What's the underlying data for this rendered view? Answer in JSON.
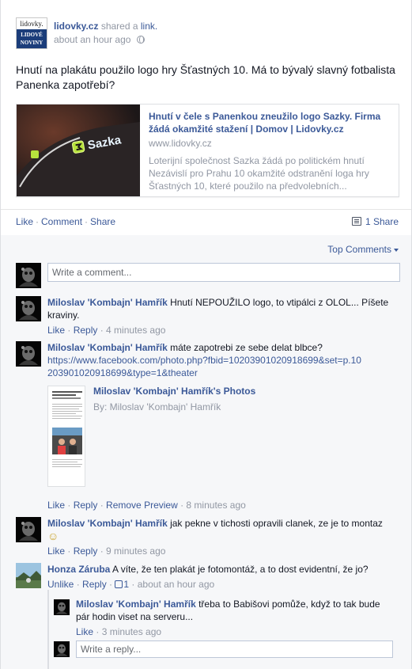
{
  "post": {
    "page_name": "lidovky.cz",
    "verb": "shared a",
    "verb_link": "link.",
    "timestamp": "about an hour ago",
    "logo_top": "lidovky.",
    "logo_bottom": "LIDOVÉ NOVINY",
    "text": "Hnutí na plakátu použilo logo hry Šťastných 10. Má to bývalý slavný fotbalista Panenka zapotřebí?",
    "preview": {
      "title": "Hnutí v čele s Panenkou zneužilo logo Sazky. Firma žádá okamžité stažení | Domov | Lidovky.cz",
      "url": "www.lidovky.cz",
      "description": "Loterijní společnost Sazka žádá po politickém hnutí Nezávislí pro Prahu 10 okamžité odstranění loga hry Šťastných 10, které použilo na předvolebních...",
      "image_text": "Sazka"
    }
  },
  "actions": {
    "like": "Like",
    "comment": "Comment",
    "share": "Share",
    "share_count": "1 Share"
  },
  "top_comments": "Top Comments",
  "comment_input_placeholder": "Write a comment...",
  "reply_input_placeholder": "Write a reply...",
  "comments": [
    {
      "author": "Miloslav 'Kombajn' Hamřík",
      "text": "Hnutí NEPOUŽILO logo, to vtipálci z OLOL... Píšete kraviny.",
      "like": "Like",
      "reply": "Reply",
      "time": "4 minutes ago"
    },
    {
      "author": "Miloslav 'Kombajn' Hamřík",
      "text": "máte zapotrebi ze sebe delat blbce?",
      "link": "https://www.facebook.com/photo.php?fbid=10203901020918699&set=p.10203901020918699&type=1&theater",
      "attachment_title": "Miloslav 'Kombajn' Hamřík's Photos",
      "attachment_by": "By: Miloslav 'Kombajn' Hamřík",
      "like": "Like",
      "reply": "Reply",
      "remove_preview": "Remove Preview",
      "time": "8 minutes ago"
    },
    {
      "author": "Miloslav 'Kombajn' Hamřík",
      "text": "jak pekne v tichosti opravili clanek, ze je to montaz",
      "emoji": "☺",
      "like": "Like",
      "reply": "Reply",
      "time": "9 minutes ago"
    },
    {
      "author": "Honza Záruba",
      "text": "A víte, že ten plakát je fotomontáž, a to dost evidentní, že jo?",
      "unlike": "Unlike",
      "reply": "Reply",
      "like_count": "1",
      "time": "about an hour ago"
    }
  ],
  "reply": {
    "author": "Miloslav 'Kombajn' Hamřík",
    "text": "třeba to Babišovi pomůže, když to tak bude pár hodin viset na serveru...",
    "like": "Like",
    "time": "3 minutes ago"
  },
  "colors": {
    "link": "#3b5998",
    "meta": "#9197a3",
    "sazka_green": "#b7e23d",
    "comments_bg": "#f6f7f9"
  }
}
